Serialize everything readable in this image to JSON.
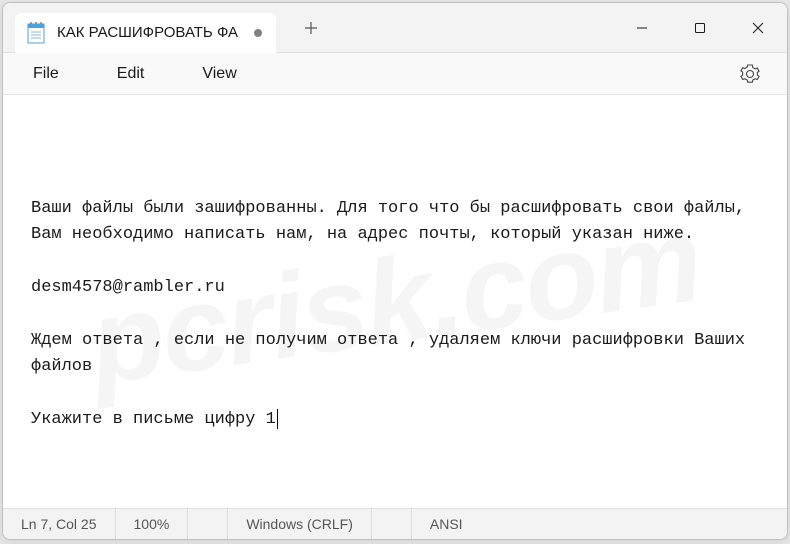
{
  "tab": {
    "title": "КАК РАСШИФРОВАТЬ ФА"
  },
  "menu": {
    "file": "File",
    "edit": "Edit",
    "view": "View"
  },
  "content": {
    "line1": "Ваши файлы были зашифрованны. Для того что бы расшифровать свои файлы, Вам необходимо написать нам, на адрес почты, который указан ниже.",
    "line2": "desm4578@rambler.ru",
    "line3": "Ждем ответа , если не получим ответа , удаляем ключи расшифровки Ваших файлов",
    "line4": "Укажите в письме цифру 1"
  },
  "statusbar": {
    "position": "Ln 7, Col 25",
    "zoom": "100%",
    "line_ending": "Windows (CRLF)",
    "encoding": "ANSI"
  },
  "watermark": "pcrisk.com"
}
